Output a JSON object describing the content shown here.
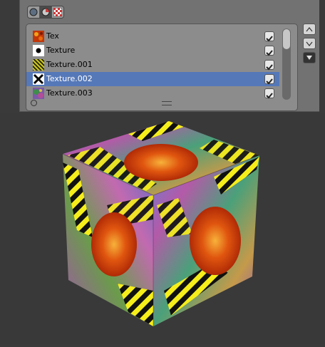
{
  "header": {
    "buttons": [
      {
        "name": "world-texture-tab",
        "icon": "sphere-icon",
        "active": false
      },
      {
        "name": "material-texture-tab",
        "icon": "material-ball-icon",
        "active": true
      },
      {
        "name": "other-texture-tab",
        "icon": "checker-icon",
        "active": false
      }
    ]
  },
  "texture_list": {
    "items": [
      {
        "label": "Tex",
        "icon": "lava-texture-icon",
        "checked": true,
        "selected": false
      },
      {
        "label": "Texture",
        "icon": "dot-texture-icon",
        "checked": true,
        "selected": false
      },
      {
        "label": "Texture.001",
        "icon": "stripes-texture-icon",
        "checked": true,
        "selected": false
      },
      {
        "label": "Texture.002",
        "icon": "cross-texture-icon",
        "checked": true,
        "selected": true
      },
      {
        "label": "Texture.003",
        "icon": "swirl-texture-icon",
        "checked": true,
        "selected": false
      }
    ]
  },
  "side_buttons": [
    {
      "name": "move-up-button",
      "icon": "triangle-up-icon"
    },
    {
      "name": "move-down-button",
      "icon": "triangle-down-icon"
    },
    {
      "name": "specials-button",
      "icon": "menu-down-icon"
    }
  ],
  "colors": {
    "selection": "#5578b8",
    "stripe_yellow": "#f6ee1a",
    "lava_red": "#d8420e"
  }
}
